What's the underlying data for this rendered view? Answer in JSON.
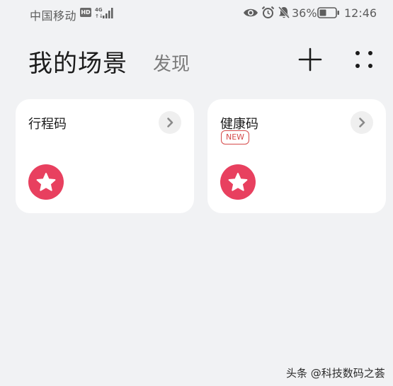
{
  "status_bar": {
    "carrier": "中国移动",
    "hd": "HD",
    "battery_percent": "36%",
    "time": "12:46"
  },
  "header": {
    "title": "我的场景",
    "tab_discover": "发现",
    "icons": [
      "add-icon",
      "more-icon"
    ]
  },
  "cards": [
    {
      "title": "行程码",
      "badge": ""
    },
    {
      "title": "健康码",
      "badge": "NEW"
    }
  ],
  "colors": {
    "background": "#f1f2f4",
    "card": "#ffffff",
    "accent_star": "#e8405f",
    "new_badge": "#d54a4a"
  },
  "watermark": "头条 @科技数码之荟"
}
